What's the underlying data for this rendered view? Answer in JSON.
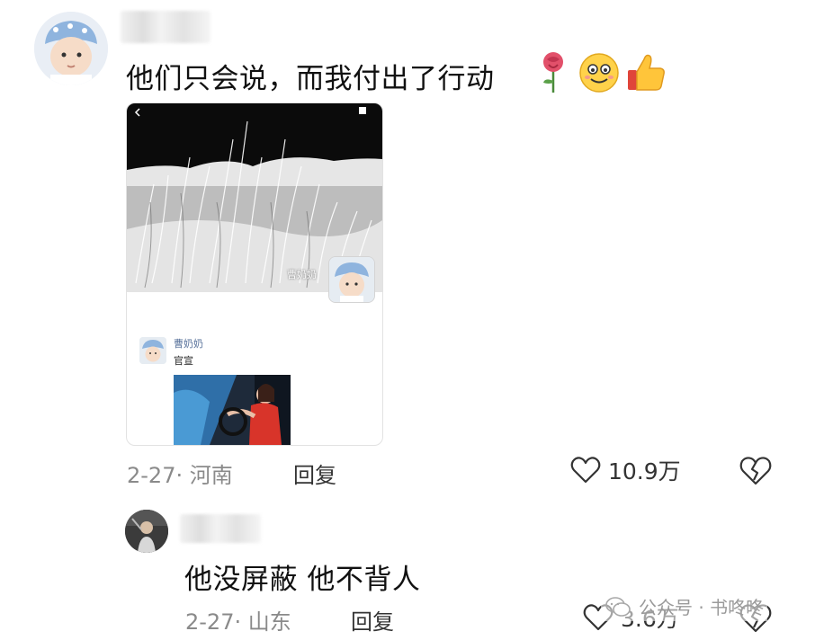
{
  "comment1": {
    "text": "他们只会说，而我付出了行动",
    "emojis": [
      "rose-emoji",
      "smiling-face-emoji",
      "thumbs-up-emoji"
    ],
    "screenshot": {
      "watermark": "曹奶奶",
      "reply_name": "曹奶奶",
      "reply_text": "官宣"
    },
    "date": "2-27",
    "location": "河南",
    "date_location": "2-27· 河南",
    "reply_label": "回复",
    "likes": "10.9万"
  },
  "comment2": {
    "text": "他没屏蔽 他不背人",
    "date_location": "2-27· 山东",
    "reply_label": "回复",
    "likes": "3.6万"
  },
  "watermark": {
    "text": "公众号 · 书咚咚"
  },
  "colors": {
    "text": "#111111",
    "meta": "#8a8a8a",
    "link": "#56709a"
  }
}
